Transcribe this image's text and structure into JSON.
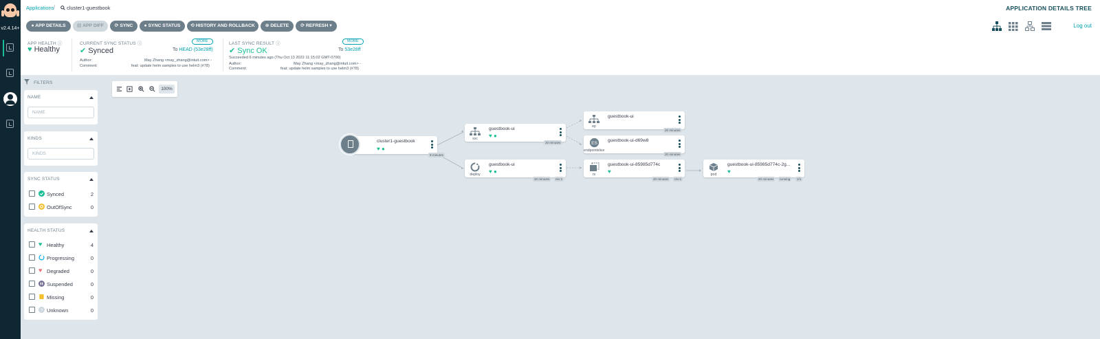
{
  "nav": {
    "version": "v2.4.14+"
  },
  "breadcrumb": {
    "root": "Applications",
    "separator": "/",
    "current": "cluster1-guestbook"
  },
  "page_title": "APPLICATION DETAILS TREE",
  "toolbar": {
    "app_details": "APP DETAILS",
    "app_diff": "APP DIFF",
    "sync": "SYNC",
    "sync_status": "SYNC STATUS",
    "history": "HISTORY AND ROLLBACK",
    "delete": "DELETE",
    "refresh": "REFRESH",
    "logout": "Log out"
  },
  "status": {
    "health_label": "APP HEALTH",
    "health_value": "Healthy",
    "sync_label": "CURRENT SYNC STATUS",
    "sync_value": "Synced",
    "sync_to_prefix": "To",
    "sync_to_link": "HEAD (53e28ff)",
    "sync_author_label": "Author:",
    "sync_author": "May Zhang <may_zhang@intuit.com> -",
    "sync_comment_label": "Comment:",
    "sync_comment": "feat: update helm samples to use helm3 (#78)",
    "more": "MORE",
    "last_label": "LAST SYNC RESULT",
    "last_value": "Sync OK",
    "last_to_prefix": "To",
    "last_to_link": "53e28ff",
    "last_detail": "Succeeded 6 minutes ago (Thu Oct 13 2022 11:15:02 GMT-0700)",
    "last_author_label": "Author:",
    "last_author": "May Zhang <may_zhang@intuit.com> -",
    "last_comment_label": "Comment:",
    "last_comment": "feat: update helm samples to use helm3 (#78)"
  },
  "filters": {
    "header": "FILTERS",
    "name_title": "NAME",
    "name_placeholder": "NAME",
    "kinds_title": "KINDS",
    "kinds_placeholder": "KINDS",
    "sync_title": "SYNC STATUS",
    "sync_items": [
      {
        "label": "Synced",
        "count": "2"
      },
      {
        "label": "OutOfSync",
        "count": "0"
      }
    ],
    "health_title": "HEALTH STATUS",
    "health_items": [
      {
        "label": "Healthy",
        "count": "4"
      },
      {
        "label": "Progressing",
        "count": "0"
      },
      {
        "label": "Degraded",
        "count": "0"
      },
      {
        "label": "Suspended",
        "count": "0"
      },
      {
        "label": "Missing",
        "count": "0"
      },
      {
        "label": "Unknown",
        "count": "0"
      }
    ]
  },
  "graph": {
    "zoom": "100%",
    "app": {
      "name": "cluster1-guestbook",
      "age": "9 minutes"
    },
    "svc": {
      "name": "guestbook-ui",
      "kind": "svc",
      "age": "20 minutes"
    },
    "deploy": {
      "name": "guestbook-ui",
      "kind": "deploy",
      "age": "20 minutes",
      "rev": "rev:1"
    },
    "ep": {
      "name": "guestbook-ui",
      "kind": "ep",
      "age": "20 minutes"
    },
    "eps": {
      "name": "guestbook-ui-d69w8",
      "kind": "endpointslice",
      "age": "20 minutes"
    },
    "rs": {
      "name": "guestbook-ui-85985d774c",
      "kind": "rs",
      "age": "20 minutes",
      "rev": "rev:1"
    },
    "pod": {
      "name": "guestbook-ui-85985d774c-2g...",
      "kind": "pod",
      "age": "20 minutes",
      "state": "running",
      "ready": "1/1"
    }
  },
  "colors": {
    "accent": "#00a2b3",
    "healthy": "#18be94",
    "nav_bg": "#0f2733",
    "canvas_bg": "#dee6eb"
  }
}
